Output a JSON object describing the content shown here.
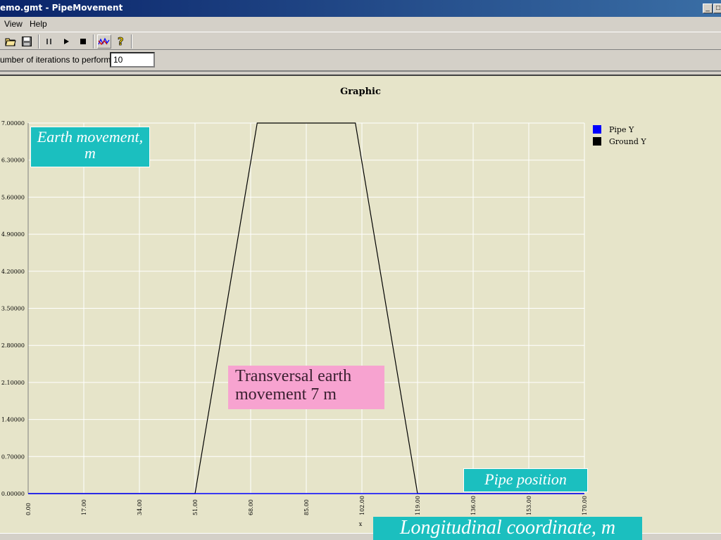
{
  "window": {
    "title": "emo.gmt - PipeMovement",
    "minimize_label": "_",
    "restore_label": "□"
  },
  "menu": {
    "view_label": "View",
    "help_label": "Help"
  },
  "toolbar": {
    "icons": [
      "open-folder-icon",
      "save-icon",
      "pause-icon",
      "play-icon",
      "stop-icon",
      "graph-icon",
      "help-icon"
    ]
  },
  "params": {
    "iterations_label": "umber of iterations to perform",
    "iterations_value": "10"
  },
  "callouts": {
    "earth_movement": "Earth movement, m",
    "pipe_position": "Pipe position",
    "longitudinal": "Longitudinal coordinate, m",
    "transversal": "Transversal earth movement 7 m"
  },
  "colors": {
    "pipe": "#0000ff",
    "ground": "#000000",
    "plot_bg": "#e6e4c9",
    "callout_cyan": "#1bbfbf",
    "callout_pink": "#f7a3d0"
  },
  "chart_data": {
    "type": "line",
    "title": "Graphic",
    "xlabel": "x",
    "ylabel": "",
    "xlim": [
      0,
      170
    ],
    "ylim": [
      0,
      7
    ],
    "x_ticks": [
      "0.00",
      "17.00",
      "34.00",
      "51.00",
      "68.00",
      "85.00",
      "102.00",
      "119.00",
      "136.00",
      "153.00",
      "170.00"
    ],
    "y_ticks": [
      "0.00000",
      "0.70000",
      "1.40000",
      "2.10000",
      "2.80000",
      "3.50000",
      "4.20000",
      "4.90000",
      "5.60000",
      "6.30000",
      "7.00000"
    ],
    "legend_position": "top-right",
    "grid": true,
    "series": [
      {
        "name": "Pipe Y",
        "color": "#0000ff",
        "x": [
          0,
          170
        ],
        "y": [
          0,
          0
        ]
      },
      {
        "name": "Ground Y",
        "color": "#000000",
        "x": [
          0,
          51,
          70,
          100,
          119,
          170
        ],
        "y": [
          0,
          0,
          7,
          7,
          0,
          0
        ]
      }
    ]
  }
}
